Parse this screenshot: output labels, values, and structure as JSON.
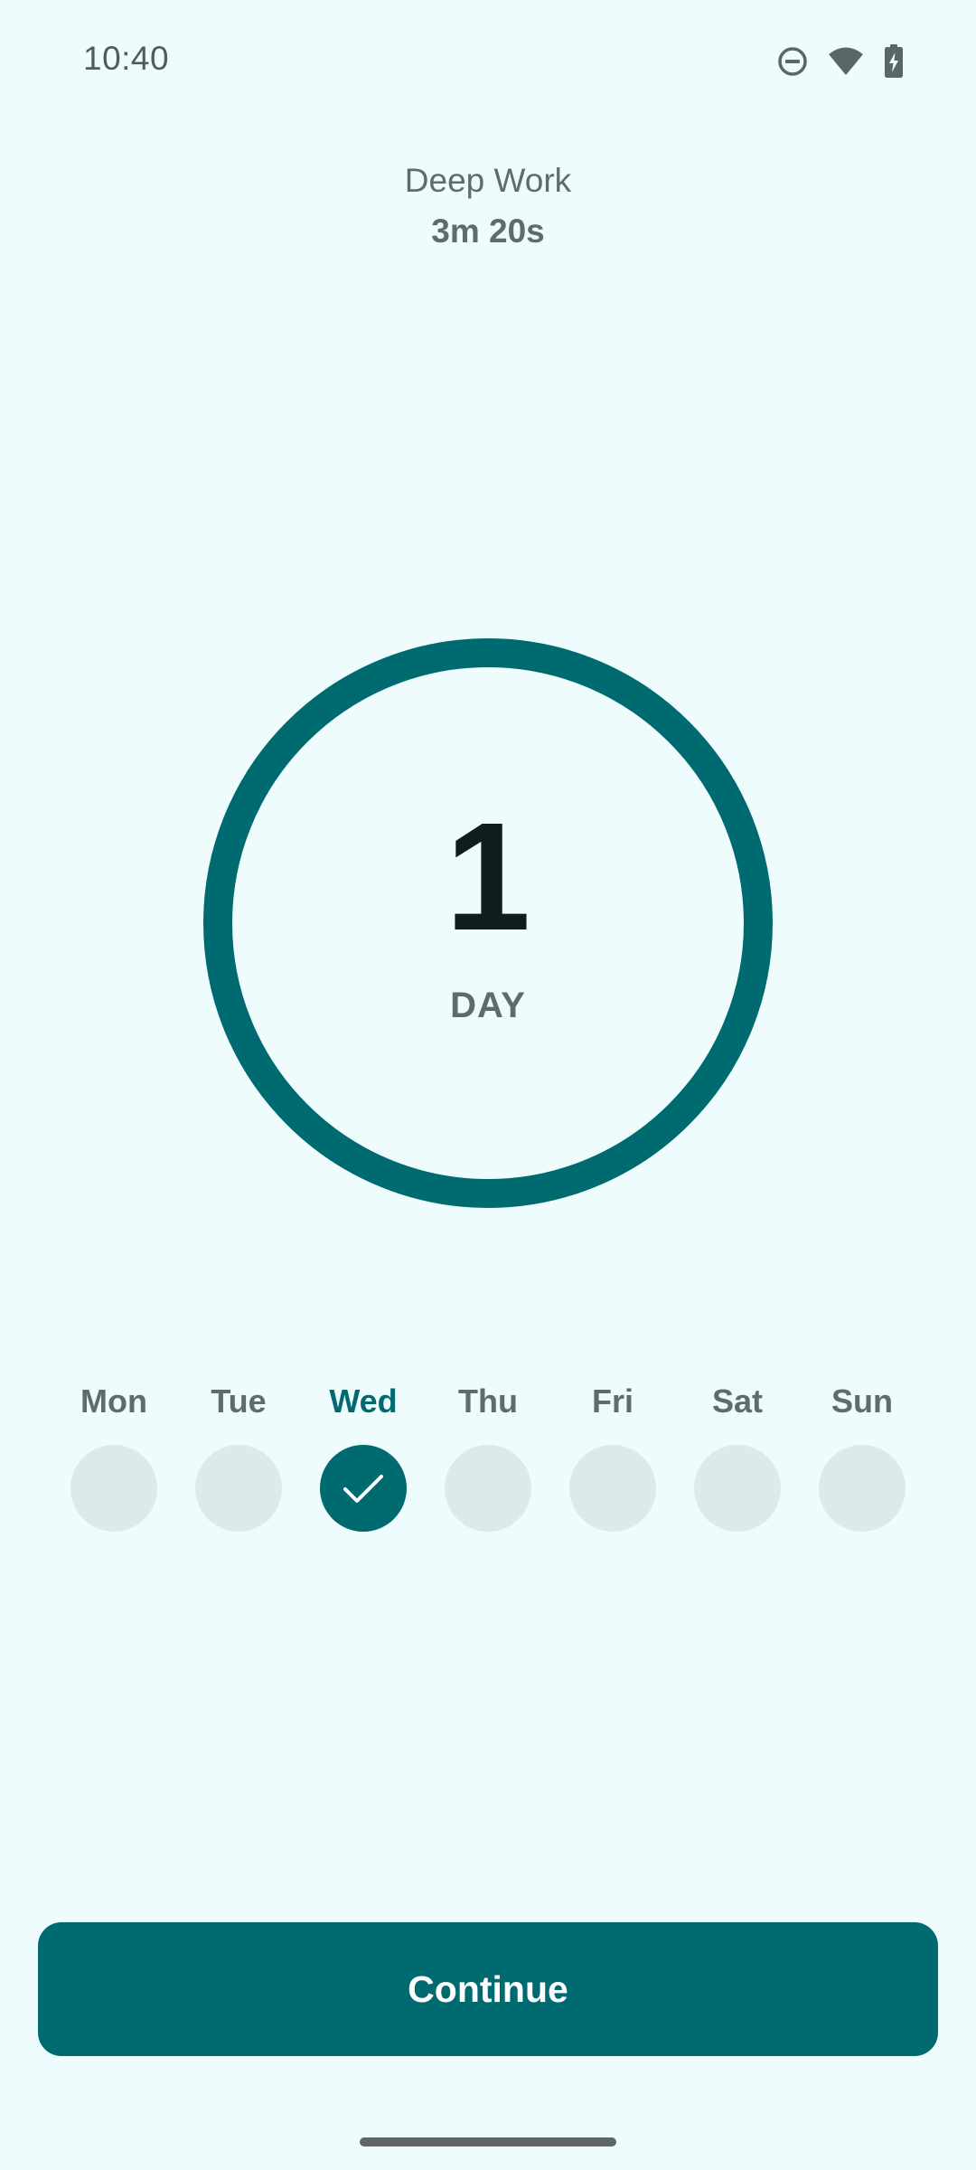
{
  "status_bar": {
    "time": "10:40",
    "icons": [
      "do-not-disturb-icon",
      "wifi-icon",
      "battery-charging-icon"
    ]
  },
  "session": {
    "name": "Deep Work",
    "duration": "3m 20s"
  },
  "streak": {
    "count": "1",
    "unit": "DAY",
    "ring_color": "#006A71"
  },
  "week": {
    "days": [
      {
        "label": "Mon",
        "completed": false
      },
      {
        "label": "Tue",
        "completed": false
      },
      {
        "label": "Wed",
        "completed": true
      },
      {
        "label": "Thu",
        "completed": false
      },
      {
        "label": "Fri",
        "completed": false
      },
      {
        "label": "Sat",
        "completed": false
      },
      {
        "label": "Sun",
        "completed": false
      }
    ]
  },
  "actions": {
    "continue_label": "Continue"
  },
  "colors": {
    "background": "#EFFCFD",
    "accent": "#006A71",
    "inactive_dot": "#DDE9EB"
  }
}
